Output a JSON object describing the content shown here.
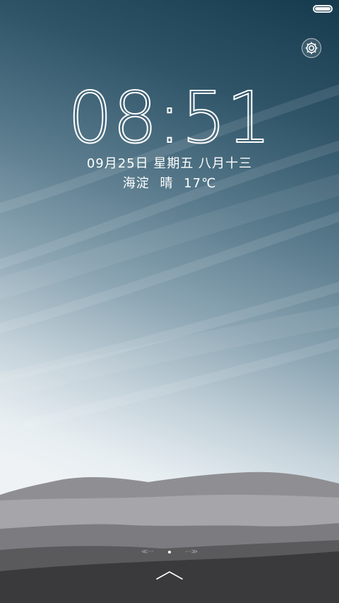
{
  "status_bar": {
    "battery_icon": "battery-full-icon",
    "battery_level": 1.0
  },
  "settings": {
    "icon": "gear-icon"
  },
  "clock": {
    "hours": "08",
    "separator": ":",
    "minutes": "51"
  },
  "date": {
    "text": "09月25日 星期五 八月十三"
  },
  "weather": {
    "location": "海淀",
    "condition": "晴",
    "temperature": "17℃"
  },
  "pager": {
    "left_hint": "≪···",
    "right_hint": "···≫",
    "active_index": 1
  },
  "unlock": {
    "icon": "chevron-up-icon"
  },
  "colors": {
    "sky_top": "#163a4d",
    "sky_bottom": "#eef2f5",
    "hill_far": "#8e8e91",
    "hill_mid": "#a9a9ad",
    "hill_near": "#6f6f72",
    "ground": "#3a3a3c"
  }
}
